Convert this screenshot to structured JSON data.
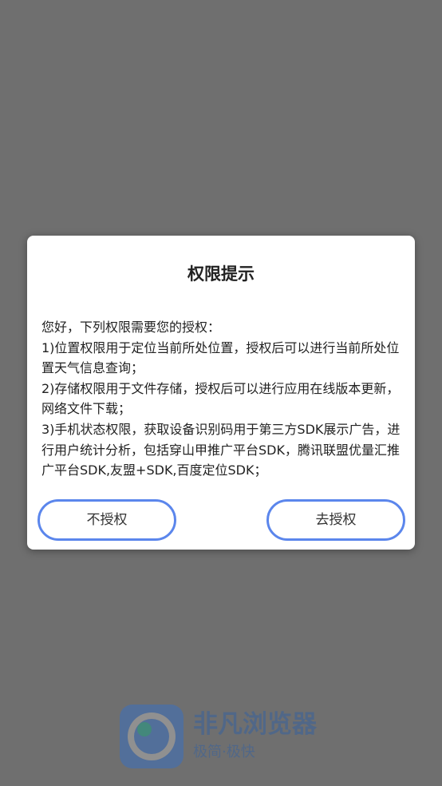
{
  "dialog": {
    "title": "权限提示",
    "body_lines": [
      "您好，下列权限需要您的授权：",
      "1)位置权限用于定位当前所处位置，授权后可以进行当前所处位置天气信息查询；",
      "2)存储权限用于文件存储，授权后可以进行应用在线版本更新，网络文件下载；",
      "3)手机状态权限，获取设备识别码用于第三方SDK展示广告，进行用户统计分析，包括穿山甲推广平台SDK，腾讯联盟优量汇推广平台SDK,友盟+SDK,百度定位SDK；"
    ],
    "deny_label": "不授权",
    "allow_label": "去授权"
  },
  "splash": {
    "app_name": "非凡浏览器",
    "slogan": "极简·极快",
    "logo_icon": "browser-eye-logo-icon"
  },
  "colors": {
    "overlay": "#6f6f6f",
    "button_border": "#5b86ec",
    "brand_blue": "#2f6fd0",
    "logo_ring": "#b9b9b9",
    "logo_dot": "#0ea88a"
  }
}
